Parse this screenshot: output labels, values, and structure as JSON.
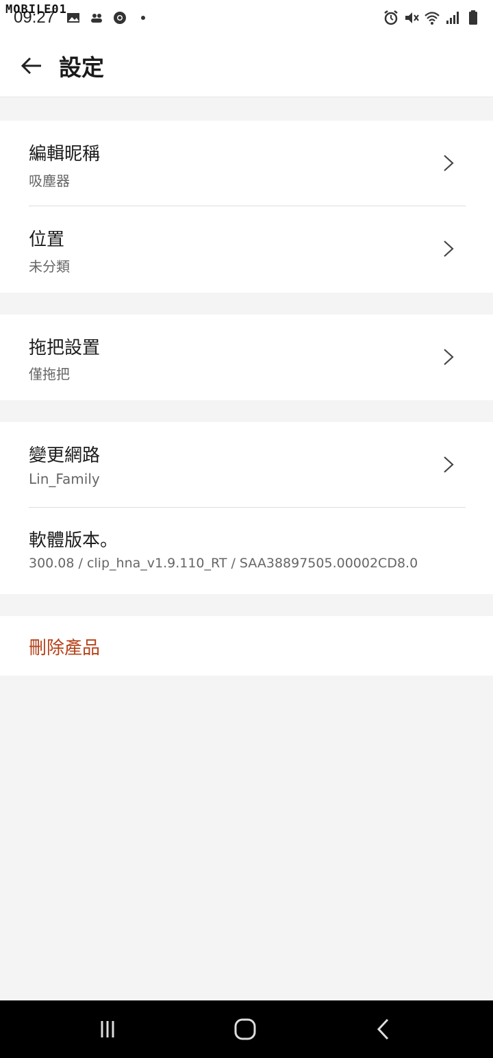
{
  "status_bar": {
    "watermark": "MOBILE01",
    "time": "09:27",
    "left_icons": [
      "image-icon",
      "people-icon",
      "chrome-icon",
      "dot-icon"
    ],
    "right_icons": [
      "alarm-icon",
      "mute-icon",
      "wifi-icon",
      "signal-icon",
      "battery-icon"
    ]
  },
  "app_bar": {
    "title": "設定"
  },
  "settings": {
    "nickname": {
      "title": "編輯昵稱",
      "value": "吸塵器"
    },
    "location": {
      "title": "位置",
      "value": "未分類"
    },
    "mop": {
      "title": "拖把設置",
      "value": "僅拖把"
    },
    "network": {
      "title": "變更網路",
      "value": "Lin_Family"
    },
    "firmware": {
      "title": "軟體版本。",
      "value": "300.08 / clip_hna_v1.9.110_RT / SAA38897505.00002CD8.0"
    },
    "delete": {
      "title": "刪除產品"
    }
  },
  "colors": {
    "danger": "#b5421a",
    "background": "#f4f4f4",
    "surface": "#ffffff"
  },
  "nav_bar": {
    "icons": [
      "recents-icon",
      "home-icon",
      "back-nav-icon"
    ]
  }
}
